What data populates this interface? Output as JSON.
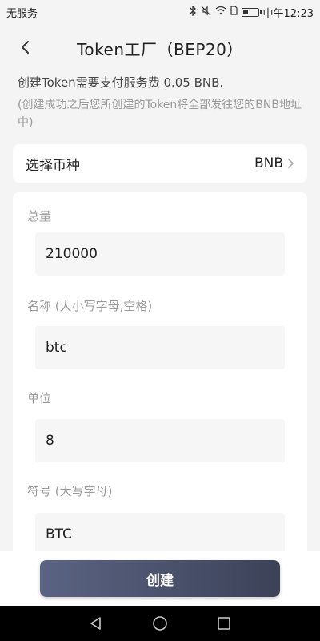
{
  "status_bar": {
    "carrier": "无服务",
    "time": "中午12:23",
    "icons": [
      "bluetooth-icon",
      "mute-icon",
      "wifi-icon",
      "sim-icon",
      "battery-icon"
    ]
  },
  "header": {
    "title": "Token工厂（BEP20）",
    "back_icon": "chevron-left-icon"
  },
  "notice": {
    "text": "创建Token需要支付服务费 0.05 BNB.",
    "subtext": "(创建成功之后您所创建的Token将全部发往您的BNB地址中)"
  },
  "coin_select": {
    "label": "选择币种",
    "value": "BNB"
  },
  "form": {
    "total": {
      "label": "总量",
      "value": "210000"
    },
    "name": {
      "label": "名称 (大小写字母,空格)",
      "value": "btc"
    },
    "decimals": {
      "label": "单位",
      "value": "8"
    },
    "symbol": {
      "label": "符号 (大写字母)",
      "value": "BTC"
    }
  },
  "actions": {
    "create_label": "创建"
  },
  "colors": {
    "background": "#f4f4f4",
    "card": "#ffffff",
    "button_start": "#5a6382",
    "button_end": "#3c4258"
  }
}
